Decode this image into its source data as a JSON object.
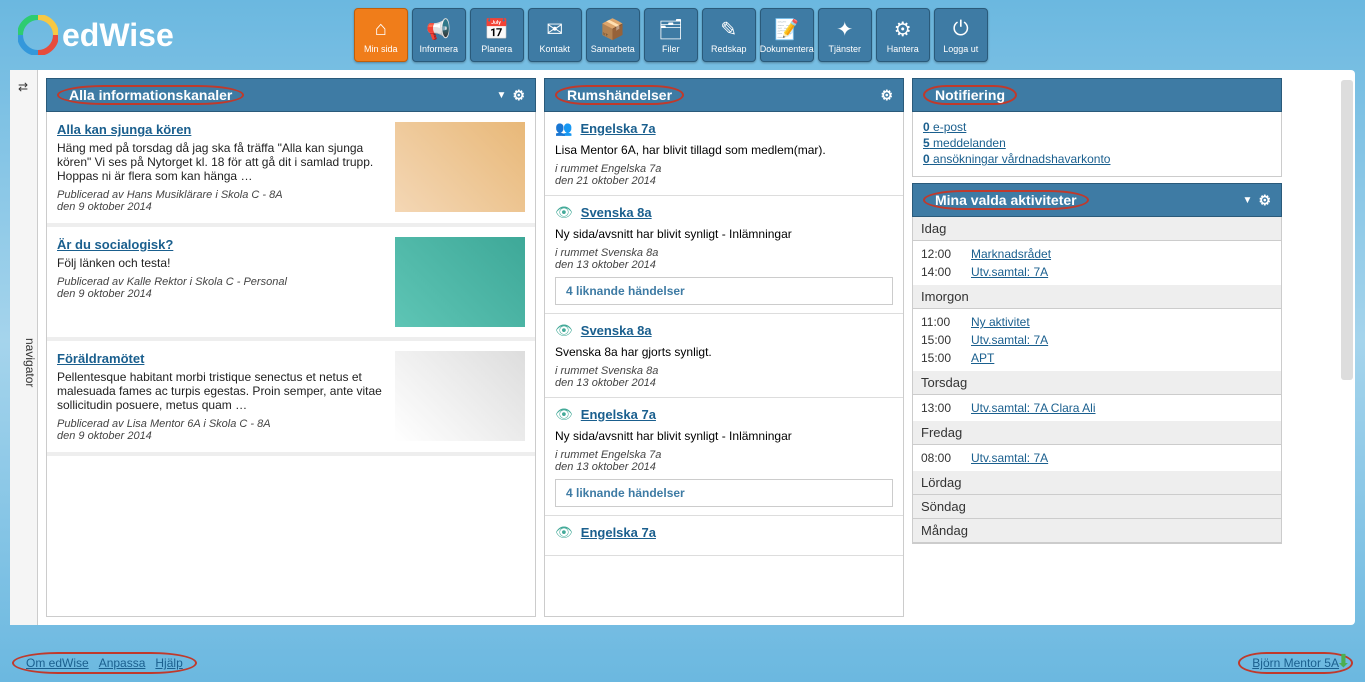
{
  "logo": "edWise",
  "nav": [
    {
      "icon": "⌂",
      "label": "Min sida",
      "active": true
    },
    {
      "icon": "📢",
      "label": "Informera"
    },
    {
      "icon": "📅",
      "label": "Planera"
    },
    {
      "icon": "✉",
      "label": "Kontakt"
    },
    {
      "icon": "📦",
      "label": "Samarbeta"
    },
    {
      "icon": "🗂",
      "label": "Filer"
    },
    {
      "icon": "✎",
      "label": "Redskap"
    },
    {
      "icon": "📝",
      "label": "Dokumentera"
    },
    {
      "icon": "✦",
      "label": "Tjänster"
    },
    {
      "icon": "⚙",
      "label": "Hantera"
    },
    {
      "icon": "⏻",
      "label": "Logga ut"
    }
  ],
  "navigator_label": "navigator",
  "panels": {
    "info": {
      "title": "Alla informationskanaler",
      "items": [
        {
          "title": "Alla kan sjunga kören",
          "desc": "Häng med på torsdag då jag ska få träffa \"Alla kan sjunga kören\" Vi ses på Nytorget kl. 18 för att gå dit i samlad trupp. Hoppas ni är flera som kan hänga …",
          "meta1": "Publicerad av Hans Musiklärare i Skola C - 8A",
          "meta2": "den 9 oktober 2014"
        },
        {
          "title": "Är du socialogisk?",
          "desc": "Följ länken och testa!",
          "meta1": "Publicerad av Kalle Rektor i Skola C - Personal",
          "meta2": "den 9 oktober 2014"
        },
        {
          "title": "Föräldramötet",
          "desc": "Pellentesque habitant morbi tristique senectus et netus et malesuada fames ac turpis egestas. Proin semper, ante vitae sollicitudin posuere, metus quam …",
          "meta1": "Publicerad av Lisa Mentor 6A i Skola C - 8A",
          "meta2": "den 9 oktober 2014"
        }
      ]
    },
    "rooms": {
      "title": "Rumshändelser",
      "items": [
        {
          "icon": "👥",
          "link": "Engelska 7a",
          "desc": "Lisa Mentor 6A, har blivit tillagd som medlem(mar).",
          "meta1": "i rummet Engelska 7a",
          "meta2": "den 21 oktober 2014"
        },
        {
          "icon": "👁",
          "link": "Svenska 8a",
          "desc": "Ny sida/avsnitt har blivit synligt - Inlämningar",
          "meta1": "i rummet Svenska 8a",
          "meta2": "den 13 oktober 2014",
          "similar": "4 liknande händelser"
        },
        {
          "icon": "👁",
          "link": "Svenska 8a",
          "desc": "Svenska 8a har gjorts synligt.",
          "meta1": "i rummet Svenska 8a",
          "meta2": "den 13 oktober 2014"
        },
        {
          "icon": "👁",
          "link": "Engelska 7a",
          "desc": "Ny sida/avsnitt har blivit synligt - Inlämningar",
          "meta1": "i rummet Engelska 7a",
          "meta2": "den 13 oktober 2014",
          "similar": "4 liknande händelser"
        },
        {
          "icon": "👁",
          "link": "Engelska 7a",
          "desc": "",
          "meta1": "",
          "meta2": ""
        }
      ]
    },
    "notif": {
      "title": "Notifiering",
      "lines": [
        {
          "count": "0",
          "text": " e-post"
        },
        {
          "count": "5",
          "text": " meddelanden"
        },
        {
          "count": "0",
          "text": " ansökningar vårdnadshavarkonto"
        }
      ]
    },
    "activities": {
      "title": "Mina valda aktiviteter",
      "days": [
        {
          "label": "Idag",
          "events": [
            {
              "time": "12:00",
              "link": "Marknadsrådet"
            },
            {
              "time": "14:00",
              "link": "Utv.samtal: 7A"
            }
          ]
        },
        {
          "label": "Imorgon",
          "events": [
            {
              "time": "11:00",
              "link": "Ny aktivitet"
            },
            {
              "time": "15:00",
              "link": "Utv.samtal: 7A"
            },
            {
              "time": "15:00",
              "link": "APT"
            }
          ]
        },
        {
          "label": "Torsdag",
          "events": [
            {
              "time": "13:00",
              "link": "Utv.samtal: 7A Clara Ali"
            }
          ]
        },
        {
          "label": "Fredag",
          "events": [
            {
              "time": "08:00",
              "link": "Utv.samtal: 7A"
            }
          ]
        },
        {
          "label": "Lördag",
          "events": []
        },
        {
          "label": "Söndag",
          "events": []
        },
        {
          "label": "Måndag",
          "events": []
        }
      ]
    }
  },
  "footer": {
    "left": [
      "Om edWise",
      "Anpassa",
      "Hjälp"
    ],
    "right": "Björn Mentor 5A"
  }
}
